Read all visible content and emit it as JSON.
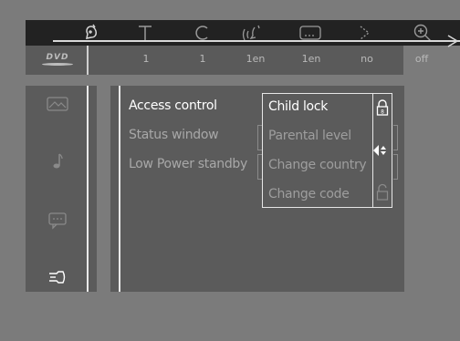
{
  "toolbar": {
    "icons": [
      "user-icon",
      "title-icon",
      "chapter-icon",
      "audio-icon",
      "subtitle-icon",
      "angle-icon",
      "zoom-icon",
      "arrow-icon"
    ]
  },
  "status": {
    "logo": "DVD",
    "values": [
      "1",
      "1",
      "1en",
      "1en",
      "no",
      "off"
    ]
  },
  "sidebar": {
    "icons": [
      "picture-icon",
      "music-note-icon",
      "speech-bubble-icon",
      "plug-icon"
    ]
  },
  "menu": {
    "items": [
      {
        "label": "Access control"
      },
      {
        "label": "Status window"
      },
      {
        "label": "Low Power standby"
      }
    ]
  },
  "submenu": {
    "items": [
      {
        "label": "Child lock"
      },
      {
        "label": "Parental level"
      },
      {
        "label": "Change country"
      },
      {
        "label": "Change code"
      }
    ]
  },
  "colors": {
    "background": "#7b7b7b",
    "panel": "#5b5b5b",
    "active_text": "#ffffff",
    "dim_text": "#a8a8a8"
  }
}
